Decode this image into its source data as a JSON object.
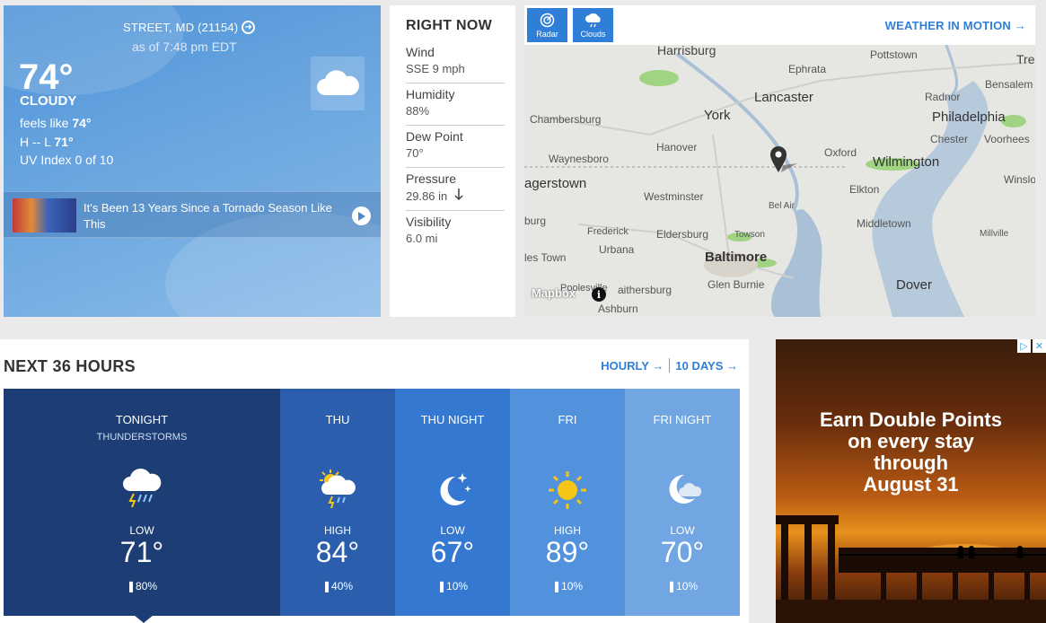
{
  "current": {
    "location": "STREET, MD (21154)",
    "as_of": "as of 7:48 pm EDT",
    "temperature": "74°",
    "condition": "CLOUDY",
    "feels_like_label": "feels like",
    "feels_like_value": "74°",
    "hi_lo_prefix": "H -- L",
    "low_value": "71°",
    "uv_index": "UV Index 0 of 10",
    "icon": "cloud-icon",
    "video_title": "It's Been 13 Years Since a Tornado Season Like This"
  },
  "right_now": {
    "title": "RIGHT NOW",
    "items": [
      {
        "label": "Wind",
        "value": "SSE 9 mph"
      },
      {
        "label": "Humidity",
        "value": "88%"
      },
      {
        "label": "Dew Point",
        "value": "70°"
      },
      {
        "label": "Pressure",
        "value": "29.86 in",
        "trend": "falling"
      },
      {
        "label": "Visibility",
        "value": "6.0 mi"
      }
    ]
  },
  "map": {
    "buttons": [
      {
        "label": "Radar",
        "icon": "radar-icon"
      },
      {
        "label": "Clouds",
        "icon": "clouds-icon"
      }
    ],
    "motion_link": "WEATHER IN MOTION",
    "attribution": "Mapbox",
    "places": [
      "Harrisburg",
      "Pottstown",
      "Tre",
      "Ephrata",
      "Radnor",
      "Bensalem",
      "Lancaster",
      "Chambersburg",
      "York",
      "Philadelphia",
      "Chester",
      "Voorhees",
      "Hanover",
      "Waynesboro",
      "Oxford",
      "Wilmington",
      "agerstown",
      "Westminster",
      "Elkton",
      "Winslo",
      "Bel Air",
      "burg",
      "Frederick",
      "Eldersburg",
      "Towson",
      "Middletown",
      "Millville",
      "Urbana",
      "les Town",
      "Baltimore",
      "Glen Burnie",
      "Dover",
      "Poolesville",
      "aithersburg",
      "Ashburn"
    ]
  },
  "next36": {
    "title": "NEXT 36 HOURS",
    "hourly_link": "HOURLY",
    "tendays_link": "10 DAYS",
    "periods": [
      {
        "name": "TONIGHT",
        "sub": "THUNDERSTORMS",
        "hl": "LOW",
        "temp": "71°",
        "precip": "80%",
        "icon": "thunderstorm-icon",
        "bg": "#1d3e74"
      },
      {
        "name": "THU",
        "sub": "",
        "hl": "HIGH",
        "temp": "84°",
        "precip": "40%",
        "icon": "scattered-thunderstorms-icon",
        "bg": "#2b5fad"
      },
      {
        "name": "THU NIGHT",
        "sub": "",
        "hl": "LOW",
        "temp": "67°",
        "precip": "10%",
        "icon": "clear-night-icon",
        "bg": "#3478d1"
      },
      {
        "name": "FRI",
        "sub": "",
        "hl": "HIGH",
        "temp": "89°",
        "precip": "10%",
        "icon": "sunny-icon",
        "bg": "#5291dc"
      },
      {
        "name": "FRI NIGHT",
        "sub": "",
        "hl": "LOW",
        "temp": "70°",
        "precip": "10%",
        "icon": "partly-cloudy-night-icon",
        "bg": "#72a6e3"
      }
    ]
  },
  "ad": {
    "text_lines": [
      "Earn Double Points",
      "on every stay",
      "through",
      "August 31"
    ]
  }
}
